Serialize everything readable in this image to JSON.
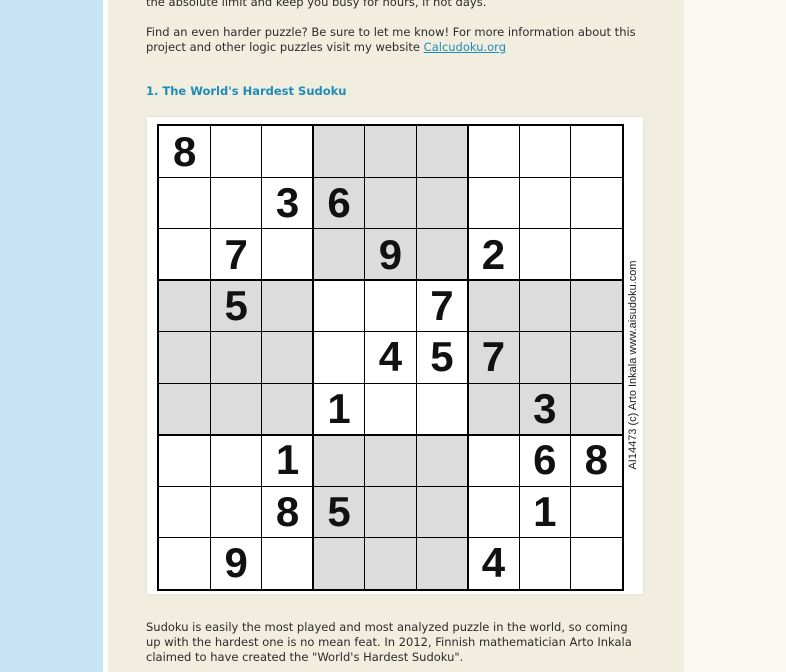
{
  "intro": {
    "line_cut": "the absolute limit and keep you busy for hours, if not days.",
    "find_text": "Find an even harder puzzle? Be sure to let me know! For more information about this project and other logic puzzles visit my website ",
    "link_text": "Calcudoku.org"
  },
  "section": {
    "heading": "1. The World's Hardest Sudoku"
  },
  "puzzle": {
    "grid": [
      [
        8,
        0,
        0,
        0,
        0,
        0,
        0,
        0,
        0
      ],
      [
        0,
        0,
        3,
        6,
        0,
        0,
        0,
        0,
        0
      ],
      [
        0,
        7,
        0,
        0,
        9,
        0,
        2,
        0,
        0
      ],
      [
        0,
        5,
        0,
        0,
        0,
        7,
        0,
        0,
        0
      ],
      [
        0,
        0,
        0,
        0,
        4,
        5,
        7,
        0,
        0
      ],
      [
        0,
        0,
        0,
        1,
        0,
        0,
        0,
        3,
        0
      ],
      [
        0,
        0,
        1,
        0,
        0,
        0,
        0,
        6,
        8
      ],
      [
        0,
        0,
        8,
        5,
        0,
        0,
        0,
        1,
        0
      ],
      [
        0,
        9,
        0,
        0,
        0,
        0,
        4,
        0,
        0
      ]
    ],
    "shade_color": "#dcdcdc",
    "watermark": "AI14473 (c) Arto Inkala www.aisudoku.com"
  },
  "outro": {
    "text": "Sudoku is easily the most played and most analyzed puzzle in the world, so coming up with the hardest one is no mean feat. In 2012, Finnish mathematician Arto Inkala claimed to have created the \"World's Hardest Sudoku\"."
  }
}
